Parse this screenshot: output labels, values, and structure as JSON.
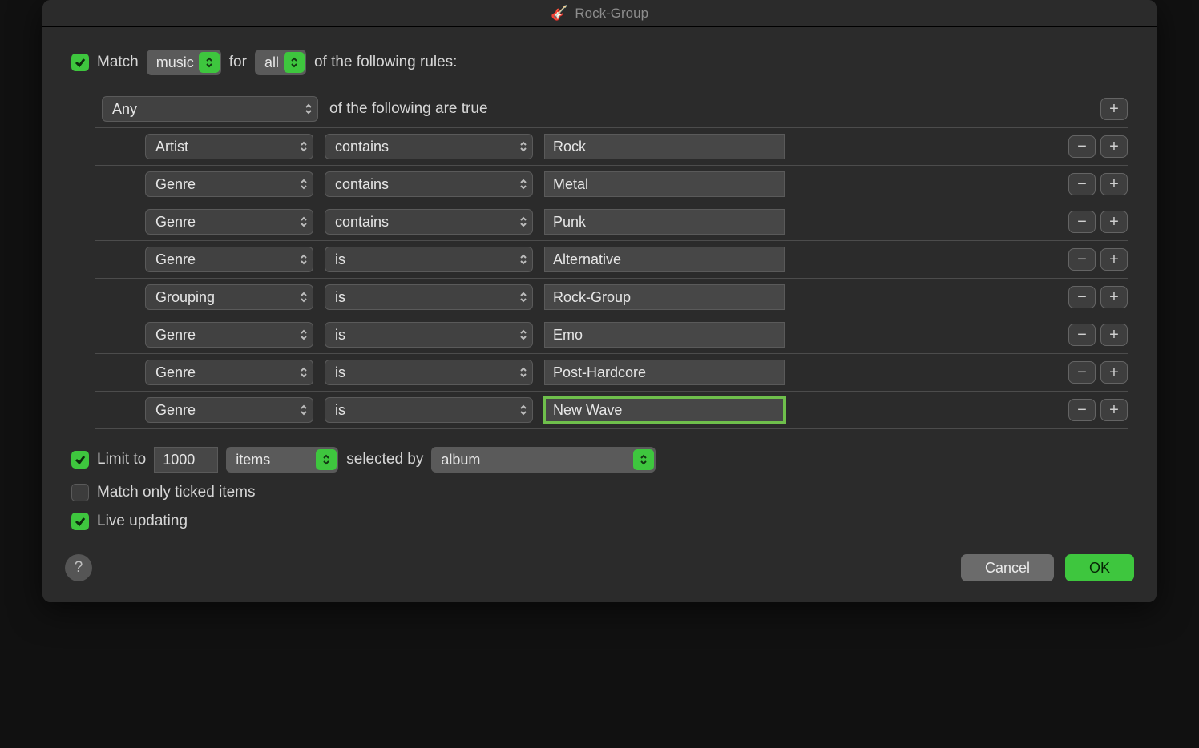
{
  "window": {
    "title": "Rock-Group"
  },
  "sentence": {
    "match": "Match",
    "media_select": "music",
    "for": "for",
    "quantifier_select": "all",
    "suffix": "of the following rules:"
  },
  "group": {
    "mode": "Any",
    "suffix": "of the following are true"
  },
  "rules": [
    {
      "field": "Artist",
      "op": "contains",
      "value": "Rock",
      "focused": false
    },
    {
      "field": "Genre",
      "op": "contains",
      "value": "Metal",
      "focused": false
    },
    {
      "field": "Genre",
      "op": "contains",
      "value": "Punk",
      "focused": false
    },
    {
      "field": "Genre",
      "op": "is",
      "value": "Alternative",
      "focused": false
    },
    {
      "field": "Grouping",
      "op": "is",
      "value": "Rock-Group",
      "focused": false
    },
    {
      "field": "Genre",
      "op": "is",
      "value": "Emo",
      "focused": false
    },
    {
      "field": "Genre",
      "op": "is",
      "value": "Post-Hardcore",
      "focused": false
    },
    {
      "field": "Genre",
      "op": "is",
      "value": "New Wave",
      "focused": true
    }
  ],
  "limit": {
    "enabled": true,
    "label": "Limit to",
    "count": "1000",
    "unit": "items",
    "selected_by_label": "selected by",
    "selected_by": "album"
  },
  "match_ticked": {
    "enabled": false,
    "label": "Match only ticked items"
  },
  "live_updating": {
    "enabled": true,
    "label": "Live updating"
  },
  "buttons": {
    "cancel": "Cancel",
    "ok": "OK"
  }
}
